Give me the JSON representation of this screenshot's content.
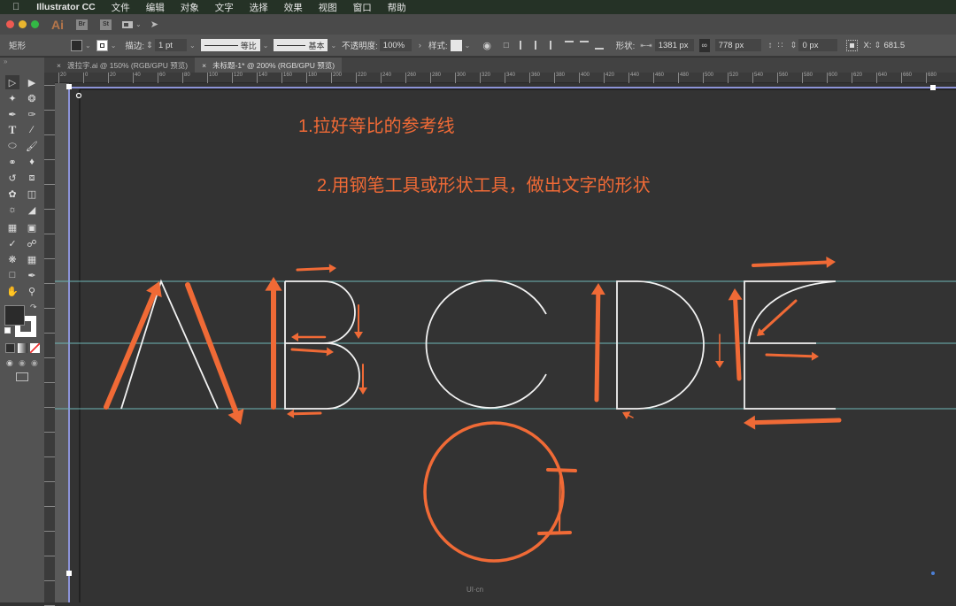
{
  "menubar": {
    "apple": "",
    "app_name": "Illustrator CC",
    "items": [
      "文件",
      "编辑",
      "对象",
      "文字",
      "选择",
      "效果",
      "视图",
      "窗口",
      "帮助"
    ]
  },
  "appbar": {
    "logo": "Ai",
    "bridge": "Br",
    "stock": "St",
    "workspace_icon": "layout-icon",
    "gpu_icon": "rocket-icon"
  },
  "control_bar": {
    "object_type": "矩形",
    "fill_color": "#2b2b2b",
    "stroke_color": "#ffffff",
    "stroke_label": "描边:",
    "stroke_weight": "1 pt",
    "variable_width": "等比",
    "brush": "基本",
    "opacity_label": "不透明度:",
    "opacity_value": "100%",
    "style_label": "样式:",
    "shape_label": "形状:",
    "width_value": "1381 px",
    "height_value": "778 px",
    "corner_value": "0 px",
    "x_label": "X:",
    "x_value": "681.5"
  },
  "tabs": [
    {
      "label": "渡拉字.ai @ 150% (RGB/GPU 预览)",
      "active": false
    },
    {
      "label": "未标题-1* @ 200% (RGB/GPU 预览)",
      "active": true
    }
  ],
  "ruler": {
    "h_ticks": [
      "20",
      "0",
      "20",
      "40",
      "60",
      "80",
      "100",
      "120",
      "140",
      "160",
      "180",
      "200",
      "220",
      "240",
      "260",
      "280",
      "300",
      "320",
      "340",
      "360",
      "380",
      "400",
      "420",
      "440",
      "460",
      "480",
      "500",
      "520",
      "540",
      "560",
      "580",
      "600",
      "620",
      "640",
      "660",
      "680"
    ]
  },
  "canvas": {
    "note1": "1.拉好等比的参考线",
    "note2": "2.用钢笔工具或形状工具，做出文字的形状",
    "letters": [
      "A",
      "B",
      "C",
      "D",
      "E"
    ],
    "accent_color": "#f06a36",
    "guide_color": "#6fb7b7",
    "glyph_stroke_color": "#f2f2f2",
    "watermark": "UI·cn"
  },
  "tools": [
    "selection",
    "direct-selection",
    "magic-wand",
    "lasso",
    "pen",
    "curvature",
    "type",
    "line",
    "ellipse",
    "paintbrush",
    "shaper",
    "eraser",
    "rotate",
    "scale",
    "warp",
    "free-transform",
    "shape-builder",
    "perspective-grid",
    "mesh",
    "gradient",
    "eyedropper",
    "blend",
    "symbol-sprayer",
    "column-graph",
    "artboard",
    "slice",
    "hand",
    "zoom"
  ]
}
